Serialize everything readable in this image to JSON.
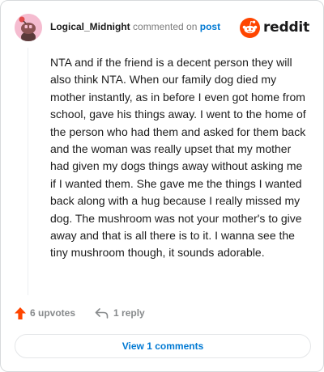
{
  "header": {
    "username": "Logical_Midnight",
    "commented_on": "commented on",
    "post_link": "post",
    "brand": "reddit"
  },
  "colors": {
    "brand": "#ff4500",
    "link": "#0079d3",
    "upvote": "#ff4500",
    "avatar_bg": "#f5bcd0"
  },
  "comment": {
    "body": "NTA and if the friend is a decent person they will also think NTA. When our family dog died my mother instantly, as in before I even got home from school, gave his things away. I went to the home of the person who had them and asked for them back and the woman was really upset that my mother had given my dogs things away without asking me if I wanted them. She gave me the things I wanted back along with a hug because I really missed my dog. The mushroom was not your mother's to give away and that is all there is to it. I wanna see the tiny mushroom though, it sounds adorable."
  },
  "actions": {
    "upvotes_label": "6 upvotes",
    "upvote_icon": "arrow-up-icon",
    "reply_label": "1 reply",
    "reply_icon": "reply-icon"
  },
  "footer": {
    "view_comments_label": "View 1 comments"
  }
}
